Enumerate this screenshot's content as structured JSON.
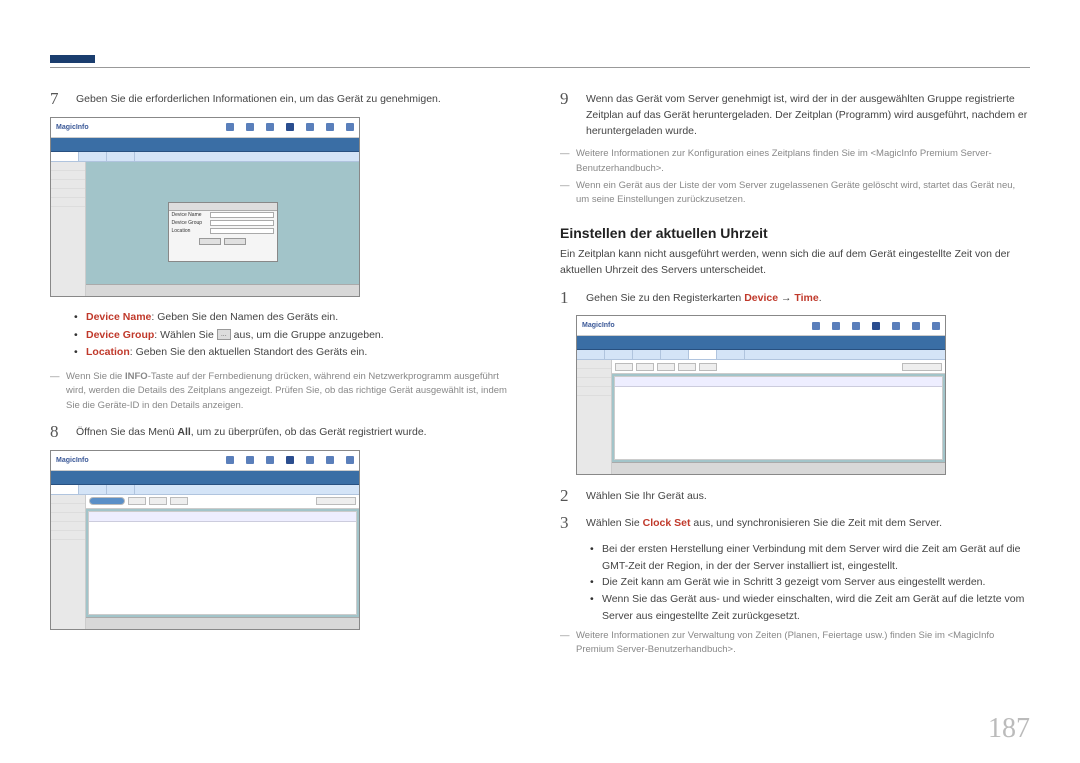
{
  "pageNumber": "187",
  "left": {
    "step7": "Geben Sie die erforderlichen Informationen ein, um das Gerät zu genehmigen.",
    "bullets": {
      "deviceNameLabel": "Device Name",
      "deviceNameText": ": Geben Sie den Namen des Geräts ein.",
      "deviceGroupLabel": "Device Group",
      "deviceGroupBefore": ": Wählen Sie ",
      "deviceGroupAfter": " aus, um die Gruppe anzugeben.",
      "btnIcon": "...",
      "locationLabel": "Location",
      "locationText": ": Geben Sie den aktuellen Standort des Geräts ein."
    },
    "note1Before": "Wenn Sie die ",
    "note1Bold": "INFO",
    "note1After": "-Taste auf der Fernbedienung drücken, während ein Netzwerkprogramm ausgeführt wird, werden die Details des Zeitplans angezeigt. Prüfen Sie, ob das richtige Gerät ausgewählt ist, indem Sie die Geräte-ID in den Details anzeigen.",
    "step8Before": "Öffnen Sie das Menü ",
    "step8Bold": "All",
    "step8After": ", um zu überprüfen, ob das Gerät registriert wurde.",
    "ssLogo": "MagicInfo"
  },
  "right": {
    "step9": "Wenn das Gerät vom Server genehmigt ist, wird der in der ausgewählten Gruppe registrierte Zeitplan auf das Gerät heruntergeladen. Der Zeitplan (Programm) wird ausgeführt, nachdem er heruntergeladen wurde.",
    "noteA": "Weitere Informationen zur Konfiguration eines Zeitplans finden Sie im <MagicInfo Premium Server-Benutzerhandbuch>.",
    "noteB": "Wenn ein Gerät aus der Liste der vom Server zugelassenen Geräte gelöscht wird, startet das Gerät neu, um seine Einstellungen zurückzusetzen.",
    "sectionTitle": "Einstellen der aktuellen Uhrzeit",
    "sectionDesc": "Ein Zeitplan kann nicht ausgeführt werden, wenn sich die auf dem Gerät eingestellte Zeit von der aktuellen Uhrzeit des Servers unterscheidet.",
    "step1Before": "Gehen Sie zu den Registerkarten ",
    "step1Device": "Device",
    "step1Arrow": " → ",
    "step1Time": "Time",
    "step1After": ".",
    "step2": "Wählen Sie Ihr Gerät aus.",
    "step3Before": "Wählen Sie ",
    "step3Bold": "Clock Set",
    "step3After": " aus, und synchronisieren Sie die Zeit mit dem Server.",
    "sub1": "Bei der ersten Herstellung einer Verbindung mit dem Server wird die Zeit am Gerät auf die GMT-Zeit der Region, in der der Server installiert ist, eingestellt.",
    "sub2": "Die Zeit kann am Gerät wie in Schritt 3 gezeigt vom Server aus eingestellt werden.",
    "sub3": "Wenn Sie das Gerät aus- und wieder einschalten, wird die Zeit am Gerät auf die letzte vom Server aus eingestellte Zeit zurückgesetzt.",
    "noteC": "Weitere Informationen zur Verwaltung von Zeiten (Planen, Feiertage usw.) finden Sie im <MagicInfo Premium Server-Benutzerhandbuch>."
  }
}
